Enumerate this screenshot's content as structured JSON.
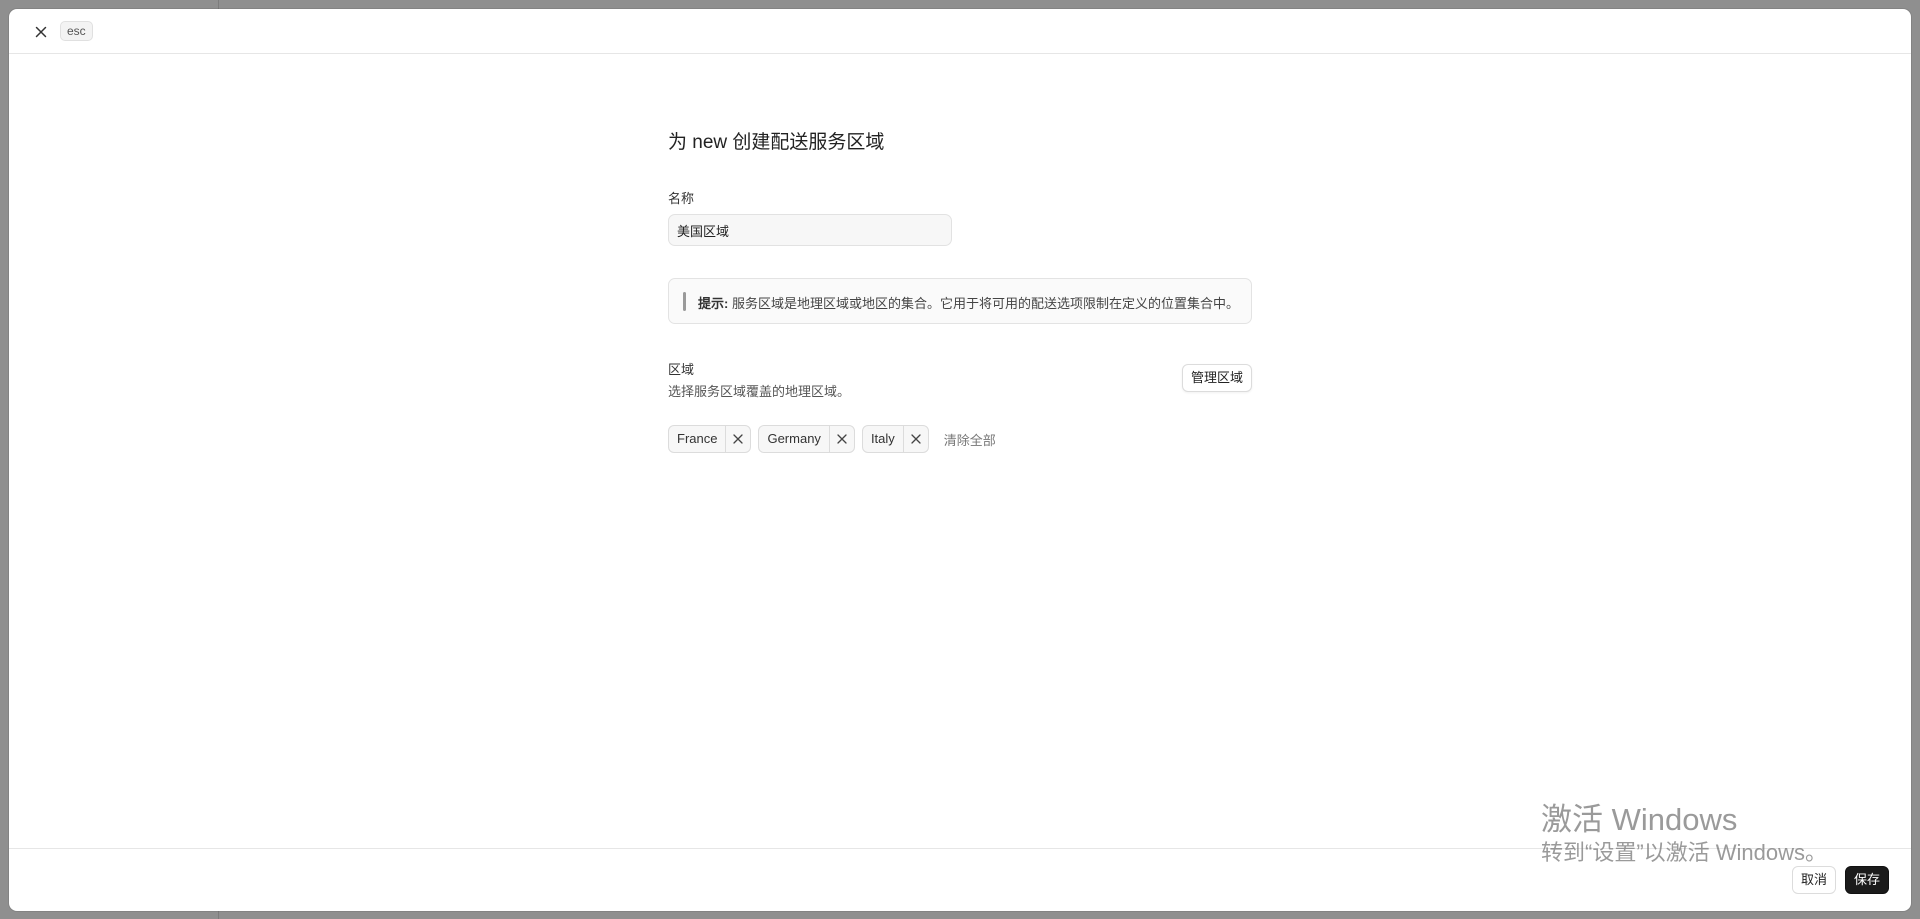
{
  "top_bar": {
    "close_icon": "close-icon",
    "esc_label": "esc"
  },
  "form": {
    "title": "为 new 创建配送服务区域",
    "name_label": "名称",
    "name_value": "美国区域",
    "hint": {
      "prefix": "提示:",
      "text": "服务区域是地理区域或地区的集合。它用于将可用的配送选项限制在定义的位置集合中。"
    },
    "regions": {
      "title": "区域",
      "description": "选择服务区域覆盖的地理区域。",
      "manage_label": "管理区域",
      "tags": [
        {
          "label": "France"
        },
        {
          "label": "Germany"
        },
        {
          "label": "Italy"
        }
      ],
      "clear_all_label": "清除全部"
    }
  },
  "footer": {
    "cancel_label": "取消",
    "save_label": "保存"
  },
  "watermark": {
    "line1": "激活 Windows",
    "line2": "转到“设置”以激活 Windows。"
  },
  "colors": {
    "primary_button_bg": "#1b1b1b",
    "backdrop": "#8f8f8f"
  }
}
